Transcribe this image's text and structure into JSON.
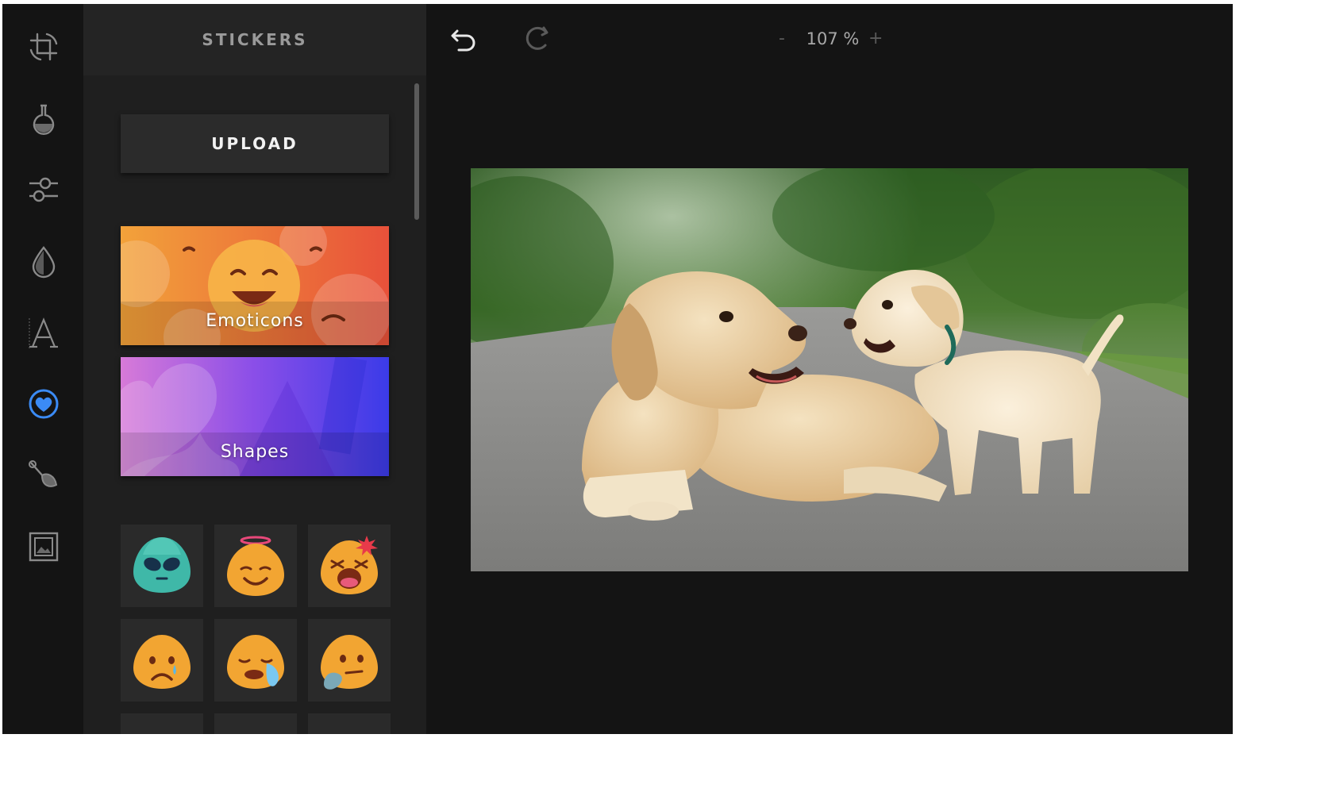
{
  "sidebar": {
    "tools": [
      {
        "name": "crop-rotate-icon",
        "active": false
      },
      {
        "name": "filter-flask-icon",
        "active": false
      },
      {
        "name": "adjust-sliders-icon",
        "active": false
      },
      {
        "name": "focus-drop-icon",
        "active": false
      },
      {
        "name": "text-icon",
        "active": false
      },
      {
        "name": "stickers-icon",
        "active": true
      },
      {
        "name": "brush-icon",
        "active": false
      },
      {
        "name": "frame-icon",
        "active": false
      }
    ],
    "active_color": "#3b8bf5",
    "icon_color": "#8a8a8a"
  },
  "panel": {
    "title": "STICKERS",
    "upload_label": "UPLOAD",
    "categories": [
      {
        "label": "Emoticons",
        "gradient": [
          "#f2a23a",
          "#e8513a"
        ]
      },
      {
        "label": "Shapes",
        "gradient": [
          "#e07ad8",
          "#3b3be8"
        ]
      }
    ],
    "stickers": [
      "alien-emoji-icon",
      "angel-emoji-icon",
      "angry-emoji-icon",
      "sad-tear-emoji-icon",
      "crying-emoji-icon",
      "thinking-emoji-icon"
    ]
  },
  "toolbar": {
    "undo_icon": "undo-icon",
    "redo_icon": "redo-icon",
    "zoom_out": "-",
    "zoom_value": "107 %",
    "zoom_in": "+"
  },
  "canvas": {
    "photo": "dog-and-puppy-photo"
  }
}
